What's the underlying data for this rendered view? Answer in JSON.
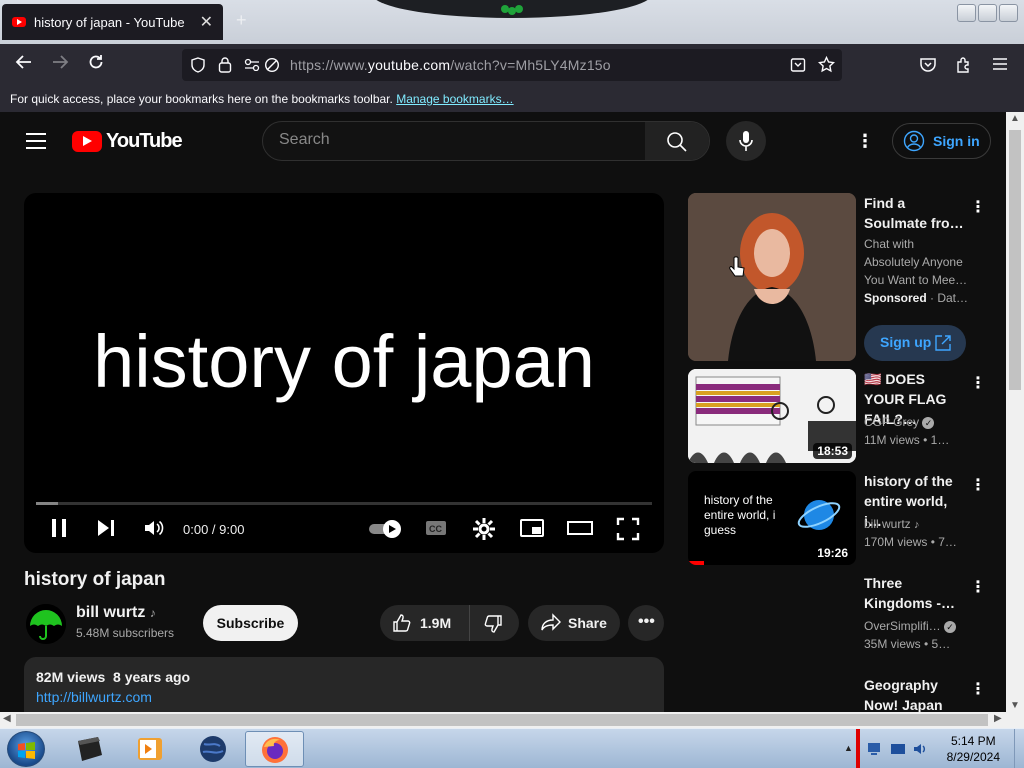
{
  "browser": {
    "tab_title": "history of japan - YouTube",
    "url_prefix": "https://www.",
    "url_host": "youtube.com",
    "url_path": "/watch?v=Mh5LY4Mz15o",
    "bookmarks_hint": "For quick access, place your bookmarks here on the bookmarks toolbar.",
    "bookmarks_link": "Manage bookmarks…"
  },
  "youtube": {
    "logo_text": "YouTube",
    "search_placeholder": "Search",
    "signin_label": "Sign in",
    "video": {
      "screen_text": "history of japan",
      "time": "0:00 / 9:00",
      "progress_loaded_fraction": 0.036,
      "title": "history of japan",
      "channel": "bill wurtz",
      "subscribers": "5.48M subscribers",
      "subscribe_label": "Subscribe",
      "likes": "1.9M",
      "share_label": "Share",
      "views_date": "82M views  8 years ago",
      "link": "http://billwurtz.com"
    },
    "recommendations": [
      {
        "title": "Find a Soulmate fro…",
        "line1": "Chat with",
        "line2": "Absolutely Anyone",
        "line3": "You Want to Mee…",
        "sponsored": "Sponsored",
        "sponsor_suffix": " · Dat…",
        "cta": "Sign up"
      },
      {
        "title": "🇺🇸 DOES YOUR FLAG FAIL?…",
        "channel": "CGP Grey",
        "stats": "11M views  • 1…",
        "duration": "18:53"
      },
      {
        "title": "history of the entire world, i…",
        "channel": "bill wurtz",
        "stats": "170M views  • 7…",
        "duration": "19:26",
        "thumb_text": "history of the entire world, i guess"
      },
      {
        "title": "Three Kingdoms -…",
        "channel": "OverSimplifi…",
        "stats": "35M views  • 5…"
      },
      {
        "title": "Geography Now! Japan"
      }
    ]
  },
  "taskbar": {
    "time": "5:14 PM",
    "date": "8/29/2024"
  }
}
